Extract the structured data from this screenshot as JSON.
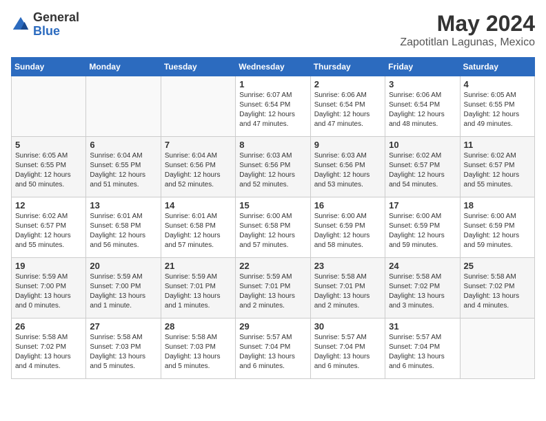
{
  "logo": {
    "general": "General",
    "blue": "Blue"
  },
  "title": "May 2024",
  "subtitle": "Zapotitlan Lagunas, Mexico",
  "weekdays": [
    "Sunday",
    "Monday",
    "Tuesday",
    "Wednesday",
    "Thursday",
    "Friday",
    "Saturday"
  ],
  "weeks": [
    [
      {
        "day": "",
        "info": ""
      },
      {
        "day": "",
        "info": ""
      },
      {
        "day": "",
        "info": ""
      },
      {
        "day": "1",
        "info": "Sunrise: 6:07 AM\nSunset: 6:54 PM\nDaylight: 12 hours and 47 minutes."
      },
      {
        "day": "2",
        "info": "Sunrise: 6:06 AM\nSunset: 6:54 PM\nDaylight: 12 hours and 47 minutes."
      },
      {
        "day": "3",
        "info": "Sunrise: 6:06 AM\nSunset: 6:54 PM\nDaylight: 12 hours and 48 minutes."
      },
      {
        "day": "4",
        "info": "Sunrise: 6:05 AM\nSunset: 6:55 PM\nDaylight: 12 hours and 49 minutes."
      }
    ],
    [
      {
        "day": "5",
        "info": "Sunrise: 6:05 AM\nSunset: 6:55 PM\nDaylight: 12 hours and 50 minutes."
      },
      {
        "day": "6",
        "info": "Sunrise: 6:04 AM\nSunset: 6:55 PM\nDaylight: 12 hours and 51 minutes."
      },
      {
        "day": "7",
        "info": "Sunrise: 6:04 AM\nSunset: 6:56 PM\nDaylight: 12 hours and 52 minutes."
      },
      {
        "day": "8",
        "info": "Sunrise: 6:03 AM\nSunset: 6:56 PM\nDaylight: 12 hours and 52 minutes."
      },
      {
        "day": "9",
        "info": "Sunrise: 6:03 AM\nSunset: 6:56 PM\nDaylight: 12 hours and 53 minutes."
      },
      {
        "day": "10",
        "info": "Sunrise: 6:02 AM\nSunset: 6:57 PM\nDaylight: 12 hours and 54 minutes."
      },
      {
        "day": "11",
        "info": "Sunrise: 6:02 AM\nSunset: 6:57 PM\nDaylight: 12 hours and 55 minutes."
      }
    ],
    [
      {
        "day": "12",
        "info": "Sunrise: 6:02 AM\nSunset: 6:57 PM\nDaylight: 12 hours and 55 minutes."
      },
      {
        "day": "13",
        "info": "Sunrise: 6:01 AM\nSunset: 6:58 PM\nDaylight: 12 hours and 56 minutes."
      },
      {
        "day": "14",
        "info": "Sunrise: 6:01 AM\nSunset: 6:58 PM\nDaylight: 12 hours and 57 minutes."
      },
      {
        "day": "15",
        "info": "Sunrise: 6:00 AM\nSunset: 6:58 PM\nDaylight: 12 hours and 57 minutes."
      },
      {
        "day": "16",
        "info": "Sunrise: 6:00 AM\nSunset: 6:59 PM\nDaylight: 12 hours and 58 minutes."
      },
      {
        "day": "17",
        "info": "Sunrise: 6:00 AM\nSunset: 6:59 PM\nDaylight: 12 hours and 59 minutes."
      },
      {
        "day": "18",
        "info": "Sunrise: 6:00 AM\nSunset: 6:59 PM\nDaylight: 12 hours and 59 minutes."
      }
    ],
    [
      {
        "day": "19",
        "info": "Sunrise: 5:59 AM\nSunset: 7:00 PM\nDaylight: 13 hours and 0 minutes."
      },
      {
        "day": "20",
        "info": "Sunrise: 5:59 AM\nSunset: 7:00 PM\nDaylight: 13 hours and 1 minute."
      },
      {
        "day": "21",
        "info": "Sunrise: 5:59 AM\nSunset: 7:01 PM\nDaylight: 13 hours and 1 minutes."
      },
      {
        "day": "22",
        "info": "Sunrise: 5:59 AM\nSunset: 7:01 PM\nDaylight: 13 hours and 2 minutes."
      },
      {
        "day": "23",
        "info": "Sunrise: 5:58 AM\nSunset: 7:01 PM\nDaylight: 13 hours and 2 minutes."
      },
      {
        "day": "24",
        "info": "Sunrise: 5:58 AM\nSunset: 7:02 PM\nDaylight: 13 hours and 3 minutes."
      },
      {
        "day": "25",
        "info": "Sunrise: 5:58 AM\nSunset: 7:02 PM\nDaylight: 13 hours and 4 minutes."
      }
    ],
    [
      {
        "day": "26",
        "info": "Sunrise: 5:58 AM\nSunset: 7:02 PM\nDaylight: 13 hours and 4 minutes."
      },
      {
        "day": "27",
        "info": "Sunrise: 5:58 AM\nSunset: 7:03 PM\nDaylight: 13 hours and 5 minutes."
      },
      {
        "day": "28",
        "info": "Sunrise: 5:58 AM\nSunset: 7:03 PM\nDaylight: 13 hours and 5 minutes."
      },
      {
        "day": "29",
        "info": "Sunrise: 5:57 AM\nSunset: 7:04 PM\nDaylight: 13 hours and 6 minutes."
      },
      {
        "day": "30",
        "info": "Sunrise: 5:57 AM\nSunset: 7:04 PM\nDaylight: 13 hours and 6 minutes."
      },
      {
        "day": "31",
        "info": "Sunrise: 5:57 AM\nSunset: 7:04 PM\nDaylight: 13 hours and 6 minutes."
      },
      {
        "day": "",
        "info": ""
      }
    ]
  ]
}
